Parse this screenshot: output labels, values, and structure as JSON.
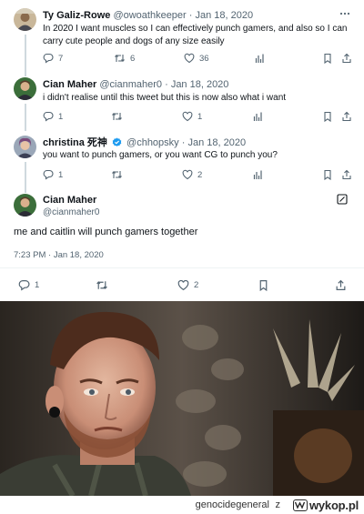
{
  "tweets": [
    {
      "name": "Ty Galiz-Rowe",
      "handle": "@owoathkeeper",
      "dot": "·",
      "date": "Jan 18, 2020",
      "text_line1": "In 2020 I want muscles so I can effectively punch gamers, and also so I can",
      "text_line2": "carry cute people and dogs of any size easily",
      "replies": "7",
      "retweets": "6",
      "likes": "36",
      "more_icon": "ellipsis-icon"
    },
    {
      "name": "Cian Maher",
      "handle": "@cianmaher0",
      "dot": "·",
      "date": "Jan 18, 2020",
      "text_line1": "i didn't realise until this tweet but this is now also what i want",
      "replies": "1",
      "retweets": "",
      "likes": "1"
    },
    {
      "name": "christina 死神",
      "handle": "@chhopsky",
      "dot": "·",
      "date": "Jan 18, 2020",
      "text_line1": "you want to punch gamers, or you want CG to punch you?",
      "replies": "1",
      "retweets": "",
      "likes": "2",
      "verified_color": "#1d9bf0"
    }
  ],
  "main_tweet": {
    "name": "Cian Maher",
    "handle": "@cianmaher0",
    "text": "me and caitlin will punch gamers together",
    "timestamp": "7:23 PM · Jan 18, 2020",
    "replies": "1",
    "retweets": "",
    "likes": "2"
  },
  "footer": {
    "username": "genocidegeneral",
    "z": "z",
    "brand": "wykop.pl"
  },
  "colors": {
    "text": "#0f1419",
    "muted": "#536471",
    "separator": "#eff3f4",
    "verified": "#1d9bf0"
  }
}
